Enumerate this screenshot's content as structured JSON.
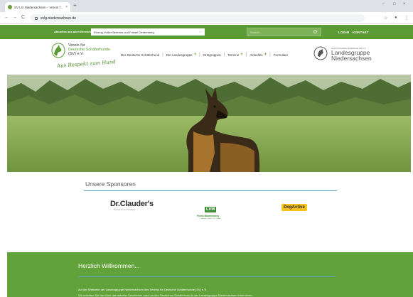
{
  "browser": {
    "tab_title": "SV LG Niedersachsen – Verein f...",
    "tab_close": "×",
    "new_tab": "+",
    "url": "svlg-niedersachsen.de",
    "window_minimize": "–",
    "window_maximize": "□",
    "window_close": "×",
    "back": "←",
    "forward": "→",
    "reload": "C",
    "extensions_icon": "⋮",
    "star_icon": "☆",
    "profile_icon": "●"
  },
  "sitebar": {
    "aktuelles_label": "Aktuelles aus allen Bereichen",
    "ticker_text": "Ehrung Volker Behrens und Friedel Oerdenberg",
    "ticker_arrows": "‹ ›",
    "search_placeholder": "Search...",
    "login_label": "LOGIN",
    "kontakt_label": "KONTAKT"
  },
  "logo": {
    "line1": "Verein für",
    "line2": "Deutsche Schäferhunde",
    "line3": "(SV) e.V.",
    "slogan": "Aus Respekt zum Hund"
  },
  "nav": {
    "items": [
      {
        "label": "Der Deutsche Schäferhund",
        "has_plus": false
      },
      {
        "label": "Die Landesgruppe",
        "has_plus": true
      },
      {
        "label": "Ortsgruppen",
        "has_plus": false
      },
      {
        "label": "Termine",
        "has_plus": true
      },
      {
        "label": "Aktuelles",
        "has_plus": true
      },
      {
        "label": "Formulare",
        "has_plus": false
      }
    ],
    "separator": "|",
    "plus": "+"
  },
  "landesgruppe": {
    "small_text": "Verein für Deutsche Schäferhunde (SV) e.V.",
    "title_line1": "Landesgruppe",
    "title_line2": "Niedersachsen"
  },
  "sponsors": {
    "title": "Unsere Sponsoren",
    "clauder": "Dr.Clauder's",
    "clauder_sub": "Tiernahrung und Tierpflege",
    "lvm": "LVM",
    "lvm_name": "Frank Blomenberg",
    "lvm_details": "Agentur · Straße · Ort · Telefon",
    "dogactive": "DogActive"
  },
  "welcome": {
    "title": "Herzlich Willkommen...",
    "text1": "Auf der Webseite der Landesgruppe Niedersachsen des Vereins für Deutsche Schäferhunde (SV) e.V.",
    "text2": "Wir möchten Sie hier über das aktuelle Geschehen rund um den Deutschen Schäferhund in der Landesgruppe Niedersachsen informieren."
  },
  "colors": {
    "brand_green": "#5a9b33",
    "welcome_green": "#62a23a",
    "accent_blue": "#5aa3c4",
    "dogactive_yellow": "#f4c21c"
  }
}
